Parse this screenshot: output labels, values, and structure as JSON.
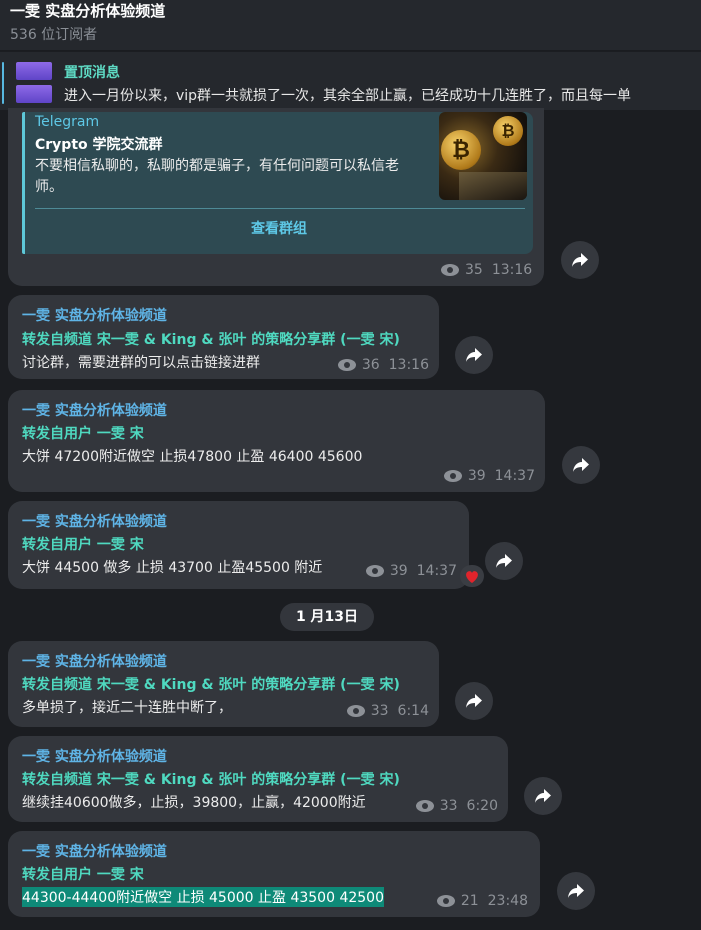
{
  "header": {
    "title": "一雯 实盘分析体验频道",
    "subscribers": "536 位订阅者"
  },
  "pinned": {
    "label": "置顶消息",
    "text": "进入一月份以来，vip群一共就损了一次，其余全部止赢，已经成功十几连胜了，而且每一单"
  },
  "messages": [
    {
      "card": {
        "site": "Telegram",
        "name": "Crypto 学院交流群",
        "description": "不要相信私聊的，私聊的都是骗子，有任何问题可以私信老师。",
        "button": "查看群组"
      },
      "views": "35",
      "time": "13:16"
    },
    {
      "author": "一雯 实盘分析体验频道",
      "forward": "转发自频道 宋一雯 & King & 张叶 的策略分享群 (一雯 宋)",
      "text": "讨论群，需要进群的可以点击链接进群",
      "views": "36",
      "time": "13:16"
    },
    {
      "author": "一雯 实盘分析体验频道",
      "forward": "转发自用户 一雯 宋",
      "text": "大饼  47200附近做空 止损47800  止盈  46400        45600",
      "views": "39",
      "time": "14:37"
    },
    {
      "author": "一雯 实盘分析体验频道",
      "forward": "转发自用户 一雯 宋",
      "text": "大饼 44500 做多 止损  43700  止盈45500 附近",
      "views": "39",
      "time": "14:37"
    },
    {
      "author": "一雯 实盘分析体验频道",
      "forward": "转发自频道 宋一雯 & King & 张叶 的策略分享群 (一雯 宋)",
      "text": "多单损了，接近二十连胜中断了，",
      "views": "33",
      "time": "6:14"
    },
    {
      "author": "一雯 实盘分析体验频道",
      "forward": "转发自频道 宋一雯 & King & 张叶 的策略分享群 (一雯 宋)",
      "text": "继续挂40600做多，止损，39800，止赢，42000附近",
      "views": "33",
      "time": "6:20"
    },
    {
      "author": "一雯 实盘分析体验频道",
      "forward": "转发自用户 一雯 宋",
      "text": "44300-44400附近做空  止损  45000 止盈  43500   42500",
      "views": "21",
      "time": "23:48"
    }
  ],
  "date_separator": "1 月13日",
  "colors": {
    "accent": "#5fb4e6",
    "forward": "#4fd9c0",
    "bubble": "#33363c",
    "highlight": "#0e8a78"
  },
  "icons": [
    "views-eye-icon",
    "share-arrow-icon",
    "heart-reaction-icon",
    "bitcoin-thumbnail"
  ]
}
